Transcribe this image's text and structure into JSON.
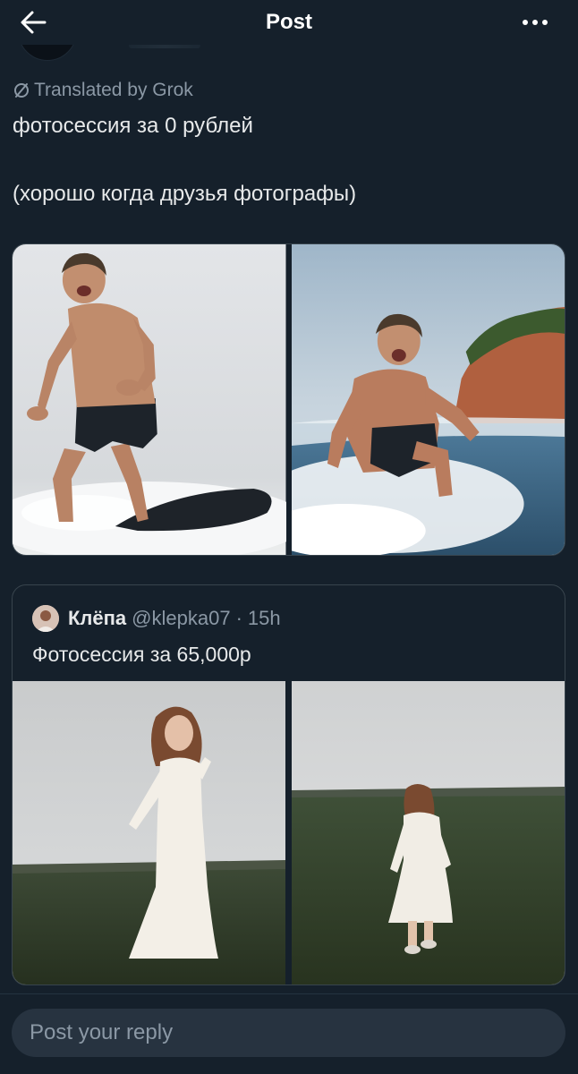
{
  "header": {
    "title": "Post",
    "back_icon": "arrow-left-icon",
    "more_icon": "more-horizontal-icon"
  },
  "post": {
    "translated_label": "Translated by Grok",
    "text_line_1": "фотосессия за 0 рублей",
    "text_line_2": "(хорошо когда друзья фотографы)",
    "media": [
      {
        "icon": "photo-surfer-standing"
      },
      {
        "icon": "photo-surfer-crouching"
      }
    ]
  },
  "quote": {
    "name": "Клёпа",
    "handle": "@klepka07",
    "dot": "·",
    "time": "15h",
    "text": "Фотосессия за 65,000р",
    "media": [
      {
        "icon": "photo-woman-white-dress-field"
      },
      {
        "icon": "photo-woman-walking-field"
      }
    ]
  },
  "reply": {
    "placeholder": "Post your reply"
  },
  "colors": {
    "background": "#15202b",
    "text": "#e7e9ea",
    "secondary_text": "#8b98a5",
    "border": "#38444d",
    "input_bg": "#273340"
  }
}
